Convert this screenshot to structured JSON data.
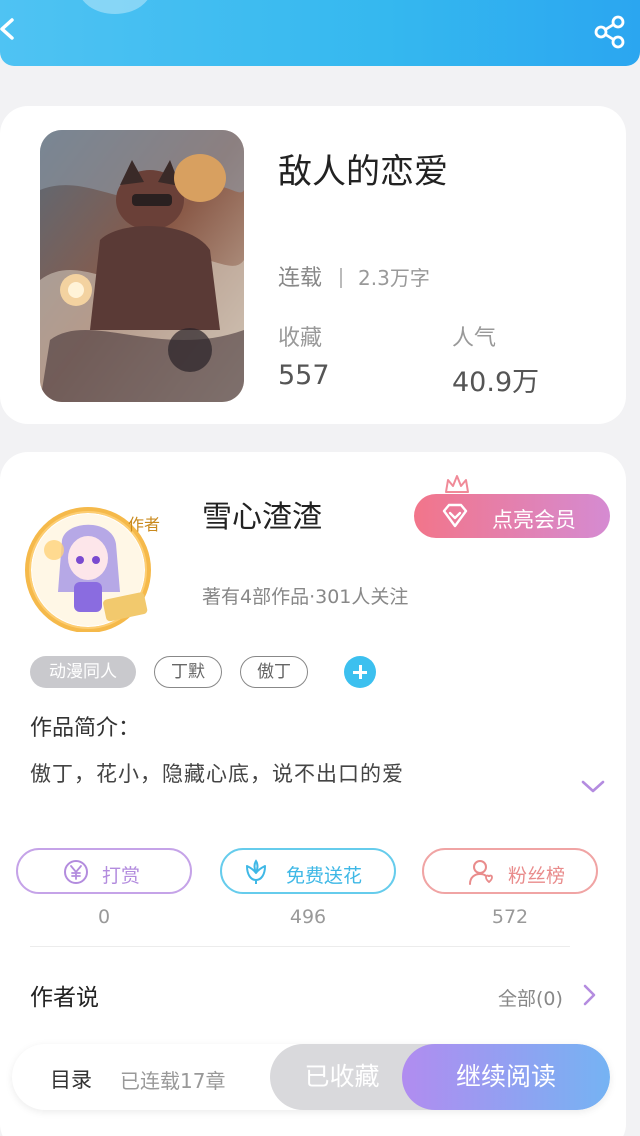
{
  "book": {
    "title": "敌人的恋爱",
    "status": "连载",
    "word_count": "2.3万字",
    "favorites_label": "收藏",
    "favorites_value": "557",
    "popularity_label": "人气",
    "popularity_value": "40.9万"
  },
  "author": {
    "name": "雪心渣渣",
    "vip_button": "点亮会员",
    "meta": "著有4部作品·301人关注",
    "avatar_badge": "作者",
    "tags": [
      "动漫同人",
      "丁默",
      "傲丁"
    ]
  },
  "intro": {
    "label": "作品简介：",
    "text": "傲丁，花小，隐藏心底，说不出口的爱"
  },
  "actions": [
    {
      "label": "打赏",
      "count": "0",
      "icon": "yen-coin-icon"
    },
    {
      "label": "免费送花",
      "count": "496",
      "icon": "flower-icon"
    },
    {
      "label": "粉丝榜",
      "count": "572",
      "icon": "fan-person-icon"
    }
  ],
  "author_says": {
    "label": "作者说",
    "all": "全部(0)"
  },
  "bottom": {
    "toc": "目录",
    "chapters": "已连载17章",
    "collected": "已收藏",
    "continue": "继续阅读"
  },
  "colors": {
    "topbar": "#35b8ef",
    "accent_blue": "#3cc0ef",
    "vip_gradient_start": "#f2758a",
    "vip_gradient_end": "#d58bd2",
    "read_gradient_start": "#b18cf0",
    "read_gradient_end": "#75b3f3"
  }
}
